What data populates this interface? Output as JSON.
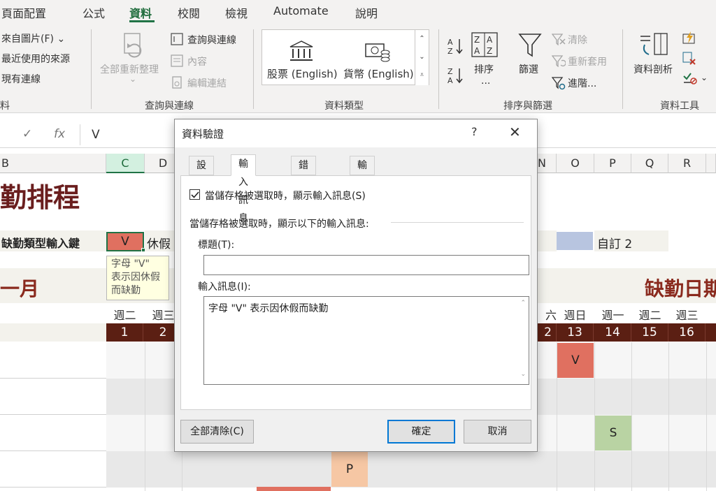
{
  "ribbon": {
    "tabs": [
      "頁面配置",
      "公式",
      "資料",
      "校閱",
      "檢視",
      "Automate",
      "說明"
    ],
    "active_tab": "資料",
    "get_data": {
      "from_picture": "來自圖片(F)",
      "recent_sources": "最近使用的來源",
      "existing_connections": "現有連線",
      "group_label_partial": "料"
    },
    "queries": {
      "refresh_all": "全部重新整理",
      "queries_connections": "查詢與連線",
      "properties": "內容",
      "edit_links": "編輯連結",
      "group_label": "查詢與連線"
    },
    "data_types": {
      "stocks": "股票 (English)",
      "currencies": "貨幣 (English)",
      "group_label": "資料類型"
    },
    "sort_filter": {
      "sort": "排序",
      "sort_more": "...",
      "filter": "篩選",
      "clear": "清除",
      "reapply": "重新套用",
      "advanced": "進階...",
      "group_label": "排序與篩選"
    },
    "data_tools": {
      "text_to_columns": "資料剖析",
      "group_label": "資料工具"
    }
  },
  "formula_bar": {
    "cancel_glyph": "✕",
    "enter_glyph": "✓",
    "fx_glyph": "fx",
    "content": "V"
  },
  "grid": {
    "columns": [
      {
        "label": "B",
        "selected": false
      },
      {
        "label": "C",
        "selected": true
      },
      {
        "label": "D",
        "selected": false
      },
      {
        "label": "N",
        "selected": false
      },
      {
        "label": "O",
        "selected": false
      },
      {
        "label": "P",
        "selected": false
      },
      {
        "label": "Q",
        "selected": false
      },
      {
        "label": "R",
        "selected": false
      }
    ],
    "title_partial": "勤排程",
    "legend_label": "缺勤類型輸入鍵",
    "legend_key": "V",
    "legend_vacation": "休假",
    "legend_custom2": "自訂 2",
    "month_partial": "一月",
    "absence_dates_partial": "缺勤日期",
    "tooltip": {
      "line1": "字母 \"V\"",
      "line2": "表示因休假",
      "line3": "而缺勤"
    },
    "weekdays_left": [
      "週二",
      "週三"
    ],
    "weekdays_right": [
      "六",
      "週日",
      "週一",
      "週二",
      "週三"
    ],
    "days_left": [
      "1",
      "2"
    ],
    "days_right": [
      "2",
      "13",
      "14",
      "15",
      "16"
    ],
    "marks": [
      {
        "code": "V",
        "label": "V"
      },
      {
        "code": "S",
        "label": "S"
      },
      {
        "code": "P",
        "label": "P"
      }
    ],
    "colors": {
      "vacation": "#e07060",
      "sick": "#b9d3a3",
      "personal": "#f6c7a4",
      "custom2": "#b8c5e0",
      "header_band": "#5b1f13"
    }
  },
  "dialog": {
    "title": "資料驗證",
    "help": "?",
    "close": "✕",
    "tabs": [
      "設定",
      "輸入訊息",
      "錯誤提醒",
      "輸入法模式"
    ],
    "active_tab": "輸入訊息",
    "show_input_checkbox": "當儲存格被選取時，顯示輸入訊息(S)",
    "show_input_checked": true,
    "section_label": "當儲存格被選取時，顯示以下的輸入訊息:",
    "title_label": "標題(T):",
    "title_value": "",
    "message_label": "輸入訊息(I):",
    "message_value": "字母 \"V\" 表示因休假而缺勤",
    "clear_all": "全部清除(C)",
    "ok": "確定",
    "cancel": "取消"
  }
}
